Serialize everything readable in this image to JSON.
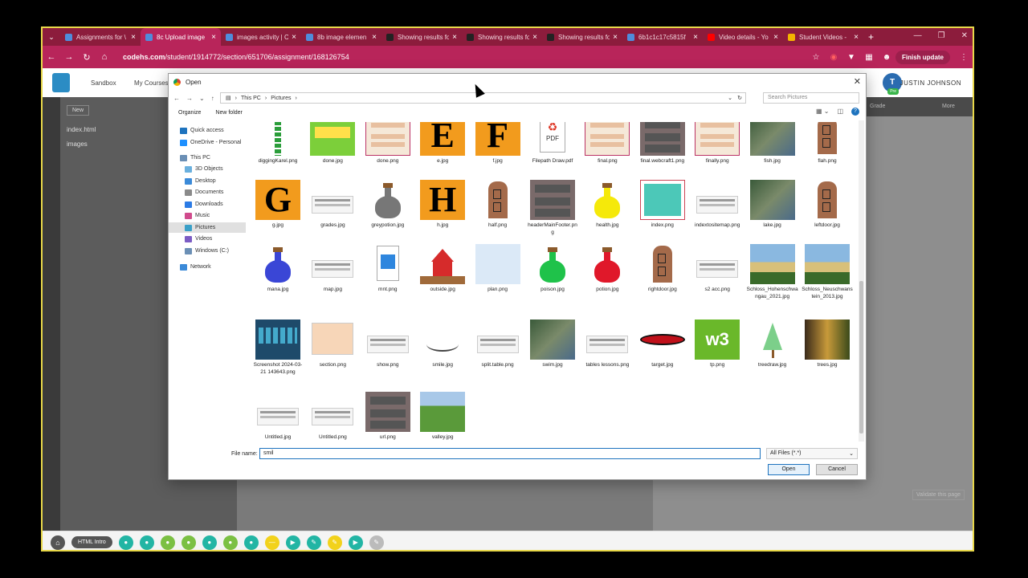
{
  "browser": {
    "tabs": [
      {
        "label": "Assignments for \\",
        "color": "#4f8ddb"
      },
      {
        "label": "8c Upload image",
        "color": "#4f8ddb",
        "active": true
      },
      {
        "label": "images activity | C",
        "color": "#4f8ddb"
      },
      {
        "label": "8b image elemen",
        "color": "#4f8ddb"
      },
      {
        "label": "Showing results fo",
        "color": "#222222"
      },
      {
        "label": "Showing results fo",
        "color": "#222222"
      },
      {
        "label": "Showing results fo",
        "color": "#222222"
      },
      {
        "label": "6b1c1c17c5815f",
        "color": "#4f8ddb"
      },
      {
        "label": "Video details - Yo",
        "color": "#ff0000"
      },
      {
        "label": "Student Videos -",
        "color": "#f4b400"
      }
    ],
    "url_host": "codehs.com",
    "url_path": "/student/1914772/section/651706/assignment/168126754",
    "finish_update": "Finish update"
  },
  "site": {
    "nav": [
      "Sandbox",
      "My Courses"
    ],
    "user": "JUSTIN JOHNSON",
    "pre_badge": "Pre",
    "new_label": "New",
    "files": [
      "index.html",
      "images"
    ],
    "grade_label": "Grade",
    "more_label": "More",
    "validate_label": "Validate this page",
    "lesson_label": "HTML Intro"
  },
  "dialog": {
    "title": "Open",
    "path": [
      "This PC",
      "Pictures"
    ],
    "search_placeholder": "Search Pictures",
    "organize": "Organize",
    "new_folder": "New folder",
    "nav": [
      "Quick access",
      "OneDrive - Personal",
      "This PC",
      "3D Objects",
      "Desktop",
      "Documents",
      "Downloads",
      "Music",
      "Pictures",
      "Videos",
      "Windows (C:)",
      "Network"
    ],
    "files": [
      {
        "name": "diggingKarel.png",
        "kind": "karel"
      },
      {
        "name": "done.jpg",
        "kind": "green"
      },
      {
        "name": "done.png",
        "kind": "doc"
      },
      {
        "name": "e.jpg",
        "kind": "letter",
        "letter": "E"
      },
      {
        "name": "f.jpg",
        "kind": "letter",
        "letter": "F"
      },
      {
        "name": "Filepath Draw.pdf",
        "kind": "pdf"
      },
      {
        "name": "final.png",
        "kind": "doc"
      },
      {
        "name": "final.webcraft1.png",
        "kind": "dark"
      },
      {
        "name": "finally.png",
        "kind": "doc"
      },
      {
        "name": "fish.jpg",
        "kind": "photo"
      },
      {
        "name": "flah.png",
        "kind": "door"
      },
      {
        "name": "g.jpg",
        "kind": "letter",
        "letter": "G"
      },
      {
        "name": "grades.jpg",
        "kind": "blank"
      },
      {
        "name": "greypotion.jpg",
        "kind": "potion",
        "color": "#777777"
      },
      {
        "name": "h.jpg",
        "kind": "letter",
        "letter": "H"
      },
      {
        "name": "half.png",
        "kind": "door"
      },
      {
        "name": "headerMainFooter.png",
        "kind": "dark"
      },
      {
        "name": "health.jpg",
        "kind": "potion",
        "color": "#f5e90a"
      },
      {
        "name": "index.png",
        "kind": "teal"
      },
      {
        "name": "indextositemap.png",
        "kind": "blank"
      },
      {
        "name": "lake.jpg",
        "kind": "photo"
      },
      {
        "name": "leftdoor.jpg",
        "kind": "door"
      },
      {
        "name": "mana.jpg",
        "kind": "potion",
        "color": "#3a46d6"
      },
      {
        "name": "map.jpg",
        "kind": "blank"
      },
      {
        "name": "mnt.png",
        "kind": "imgicon"
      },
      {
        "name": "outside.jpg",
        "kind": "house"
      },
      {
        "name": "plan.png",
        "kind": "plan"
      },
      {
        "name": "poison.jpg",
        "kind": "potion",
        "color": "#1fc24a"
      },
      {
        "name": "potion.jpg",
        "kind": "potion",
        "color": "#e0182a"
      },
      {
        "name": "rightdoor.jpg",
        "kind": "door"
      },
      {
        "name": "s2 acc.png",
        "kind": "blank"
      },
      {
        "name": "Schloss_Hohenschwangau_2021.jpg",
        "kind": "castle"
      },
      {
        "name": "Schloss_Neuschwanstein_2013.jpg",
        "kind": "castle"
      },
      {
        "name": "Screenshot 2024-03-21 143643.png",
        "kind": "screenshot"
      },
      {
        "name": "section.png",
        "kind": "peach"
      },
      {
        "name": "show.png",
        "kind": "blank"
      },
      {
        "name": "smile.jpg",
        "kind": "smile"
      },
      {
        "name": "split.table.png",
        "kind": "blank"
      },
      {
        "name": "swim.jpg",
        "kind": "photo"
      },
      {
        "name": "tables lessons.png",
        "kind": "blank"
      },
      {
        "name": "target.jpg",
        "kind": "target"
      },
      {
        "name": "tp.png",
        "kind": "w3"
      },
      {
        "name": "treedraw.jpg",
        "kind": "tree"
      },
      {
        "name": "trees.jpg",
        "kind": "forest"
      },
      {
        "name": "Untitled.jpg",
        "kind": "blank"
      },
      {
        "name": "Untitled.png",
        "kind": "blank"
      },
      {
        "name": "url.png",
        "kind": "dark"
      },
      {
        "name": "valley.jpg",
        "kind": "valley"
      }
    ],
    "file_name_label": "File name:",
    "file_name_value": "smil",
    "file_type": "All Files (*.*)",
    "open_label": "Open",
    "cancel_label": "Cancel"
  }
}
